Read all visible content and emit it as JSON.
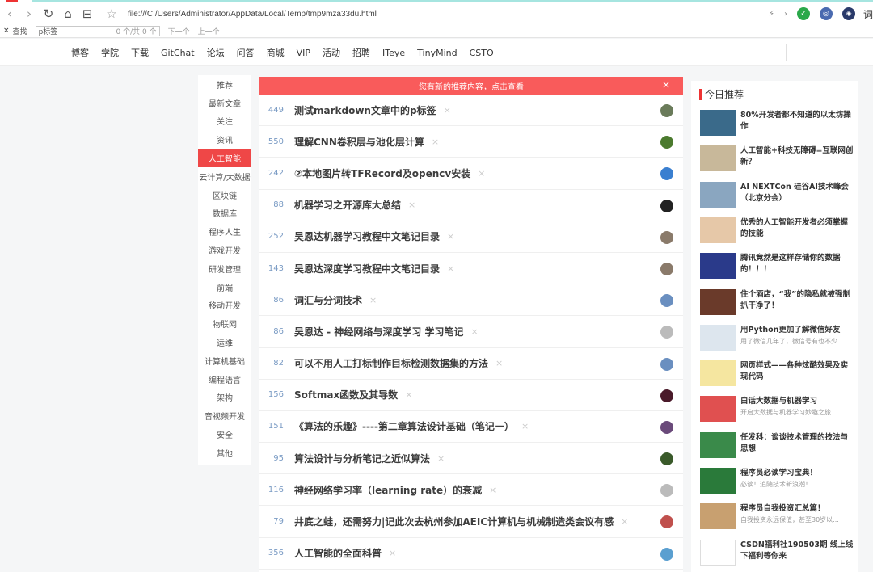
{
  "browser": {
    "back_icon": "back-arrow-icon",
    "url": "file:///C:/Users/Administrator/AppData/Local/Temp/tmp9mza33du.html",
    "right_icons": [
      "lightning-icon",
      "chevron-right-icon",
      "extension-icon",
      "extension-icon",
      "shield-icon"
    ],
    "right_text": "词"
  },
  "find": {
    "close": "×",
    "label": "查找",
    "value": "p标签",
    "count": "0 个/共 0 个",
    "next": "下一个",
    "prev": "上一个"
  },
  "nav": {
    "items": [
      "博客",
      "学院",
      "下载",
      "GitChat",
      "论坛",
      "问答",
      "商城",
      "VIP",
      "活动",
      "招聘",
      "ITeye",
      "TinyMind",
      "CSTO"
    ]
  },
  "categories": [
    "推荐",
    "最新文章",
    "关注",
    "资讯",
    "人工智能",
    "云计算/大数据",
    "区块链",
    "数据库",
    "程序人生",
    "游戏开发",
    "研发管理",
    "前端",
    "移动开发",
    "物联网",
    "运维",
    "计算机基础",
    "编程语言",
    "架构",
    "音视频开发",
    "安全",
    "其他"
  ],
  "active_category": "人工智能",
  "notice": {
    "text": "您有新的推荐内容，点击查看",
    "close": "×"
  },
  "articles": [
    {
      "num": "449",
      "title": "测试markdown文章中的p标签",
      "color": "#6a7b5a"
    },
    {
      "num": "550",
      "title": "理解CNN卷积层与池化层计算",
      "color": "#4b7a2e"
    },
    {
      "num": "242",
      "title": "②本地图片转TFRecord及opencv安装",
      "color": "#3a7fd0"
    },
    {
      "num": "88",
      "title": "机器学习之开源库大总结",
      "color": "#222222"
    },
    {
      "num": "252",
      "title": "吴恩达机器学习教程中文笔记目录",
      "color": "#8a7a6a"
    },
    {
      "num": "143",
      "title": "吴恩达深度学习教程中文笔记目录",
      "color": "#8a7a6a"
    },
    {
      "num": "86",
      "title": "词汇与分词技术",
      "color": "#6a8fc0"
    },
    {
      "num": "86",
      "title": "吴恩达 - 神经网络与深度学习 学习笔记",
      "color": "#bbbbbb"
    },
    {
      "num": "82",
      "title": "可以不用人工打标制作目标检测数据集的方法",
      "color": "#6a8fc0"
    },
    {
      "num": "156",
      "title": "Softmax函数及其导数",
      "color": "#4a1a2a"
    },
    {
      "num": "151",
      "title": "《算法的乐趣》----第二章算法设计基础（笔记一）",
      "color": "#6a4a7a"
    },
    {
      "num": "95",
      "title": "算法设计与分析笔记之近似算法",
      "color": "#3a5a2a"
    },
    {
      "num": "116",
      "title": "神经网络学习率（learning rate）的衰减",
      "color": "#bbbbbb"
    },
    {
      "num": "79",
      "title": "井底之蛙，还需努力|记此次去杭州参加AEIC计算机与机械制造类会议有感",
      "color": "#c0504d"
    },
    {
      "num": "356",
      "title": "人工智能的全面科普",
      "color": "#5a9fd0"
    }
  ],
  "delete_mark": "×",
  "today": {
    "title": "今日推荐",
    "items": [
      {
        "t1": "80%开发者都不知道的以太坊操作",
        "t2": "",
        "color": "#3a6a8a"
      },
      {
        "t1": "人工智能+科技无障碍=互联网创新？",
        "t2": "",
        "color": "#c8b89a"
      },
      {
        "t1": "AI NEXTCon 硅谷AI技术峰会（北京分会）",
        "t2": "",
        "color": "#8aa6c0"
      },
      {
        "t1": "优秀的人工智能开发者必须掌握的技能",
        "t2": "",
        "color": "#e6c8a8"
      },
      {
        "t1": "腾讯竟然是这样存储你的数据的！！！",
        "t2": "",
        "color": "#2a3a8a"
      },
      {
        "t1": "住个酒店，“我”的隐私就被强制扒干净了！",
        "t2": "",
        "color": "#6a3a2a"
      },
      {
        "t1": "用Python更加了解微信好友",
        "t2": "用了微信几年了，微信号有也不少...",
        "color": "#dde6ee"
      },
      {
        "t1": "网页样式——各种炫酷效果及实现代码",
        "t2": "",
        "color": "#f5e6a0"
      },
      {
        "t1": "白话大数据与机器学习",
        "t2": "开启大数据与机器学习妙趣之旅",
        "color": "#e05050"
      },
      {
        "t1": "任发科：谈谈技术管理的技法与思想",
        "t2": "",
        "color": "#3a8a4a"
      },
      {
        "t1": "程序员必读学习宝典！",
        "t2": "必读！追随技术新浪潮！",
        "color": "#2a7a3a"
      },
      {
        "t1": "程序员自我投资汇总篇！",
        "t2": "自我投资永远保值，甚至30岁以...",
        "color": "#c8a070"
      },
      {
        "t1": "CSDN福利社190503期 线上线下福利等你来",
        "t2": "",
        "color": "#ffffff"
      }
    ]
  }
}
